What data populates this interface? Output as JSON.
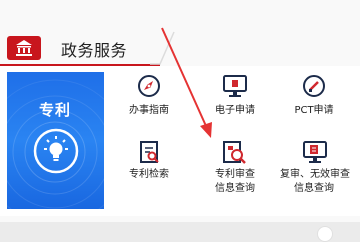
{
  "section": {
    "title": "政务服务",
    "badge_icon": "government-building-icon",
    "accent": "#c8161d"
  },
  "patent_tile": {
    "label": "专利",
    "icon": "lightbulb-icon",
    "color": "#2a7cf0"
  },
  "services": [
    {
      "label": "办事指南",
      "icon": "compass-icon"
    },
    {
      "label": "电子申请",
      "icon": "monitor-icon"
    },
    {
      "label": "PCT申请",
      "icon": "pct-icon"
    },
    {
      "label": "专利检索",
      "icon": "document-search-icon"
    },
    {
      "label_line1": "专利审查",
      "label_line2": "信息查询",
      "icon": "magnifier-document-icon"
    },
    {
      "label_line1": "复审、无效审查",
      "label_line2": "信息查询",
      "icon": "monitor-document-icon"
    }
  ],
  "annotation": {
    "icon": "red-arrow-annotation",
    "color": "#e53333"
  }
}
